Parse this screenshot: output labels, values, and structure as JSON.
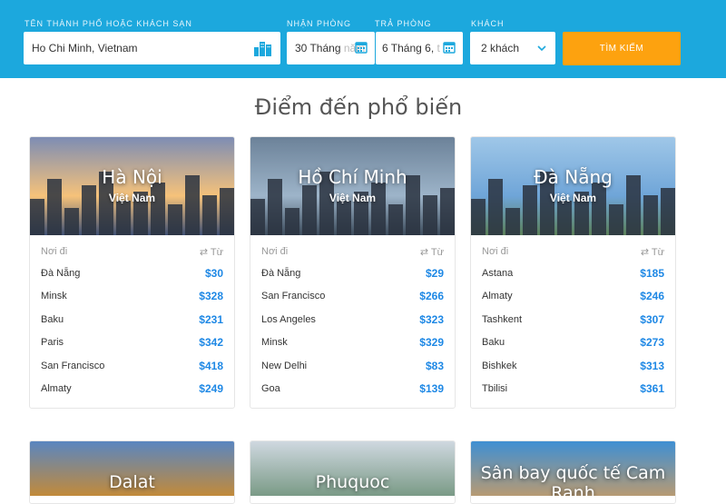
{
  "search": {
    "destination_label": "TÊN THÀNH PHỐ HOẶC KHÁCH SẠN",
    "destination_value": "Ho Chi Minh, Vietnam",
    "checkin_label": "NHẬN PHÒNG",
    "checkin_value": "30 Tháng",
    "checkin_faded": "năm",
    "checkout_label": "TRẢ PHÒNG",
    "checkout_value": "6 Tháng 6,",
    "checkout_faded": "t",
    "guests_label": "KHÁCH",
    "guests_value": "2 khách",
    "submit_label": "TÌM KIẾM",
    "accent": "#1ca8dd",
    "button_color": "#fda20f"
  },
  "section_title": "Điểm đến phổ biến",
  "cards": [
    {
      "city": "Hà Nội",
      "country": "Việt Nam",
      "origin_header": "Nơi đi",
      "price_header": "⇄ Từ",
      "routes": [
        {
          "origin": "Đà Nẵng",
          "price": "$30"
        },
        {
          "origin": "Minsk",
          "price": "$328"
        },
        {
          "origin": "Baku",
          "price": "$231"
        },
        {
          "origin": "Paris",
          "price": "$342"
        },
        {
          "origin": "San Francisco",
          "price": "$418"
        },
        {
          "origin": "Almaty",
          "price": "$249"
        }
      ]
    },
    {
      "city": "Hồ Chí Minh",
      "country": "Việt Nam",
      "origin_header": "Nơi đi",
      "price_header": "⇄ Từ",
      "routes": [
        {
          "origin": "Đà Nẵng",
          "price": "$29"
        },
        {
          "origin": "San Francisco",
          "price": "$266"
        },
        {
          "origin": "Los Angeles",
          "price": "$323"
        },
        {
          "origin": "Minsk",
          "price": "$329"
        },
        {
          "origin": "New Delhi",
          "price": "$83"
        },
        {
          "origin": "Goa",
          "price": "$139"
        }
      ]
    },
    {
      "city": "Đà Nẵng",
      "country": "Việt Nam",
      "origin_header": "Nơi đi",
      "price_header": "⇄ Từ",
      "routes": [
        {
          "origin": "Astana",
          "price": "$185"
        },
        {
          "origin": "Almaty",
          "price": "$246"
        },
        {
          "origin": "Tashkent",
          "price": "$307"
        },
        {
          "origin": "Baku",
          "price": "$273"
        },
        {
          "origin": "Bishkek",
          "price": "$313"
        },
        {
          "origin": "Tbilisi",
          "price": "$361"
        }
      ]
    }
  ],
  "bottom_cards": [
    {
      "city": "Dalat"
    },
    {
      "city": "Phuquoc"
    },
    {
      "city": "Sân bay quốc tế Cam Ranh"
    }
  ]
}
